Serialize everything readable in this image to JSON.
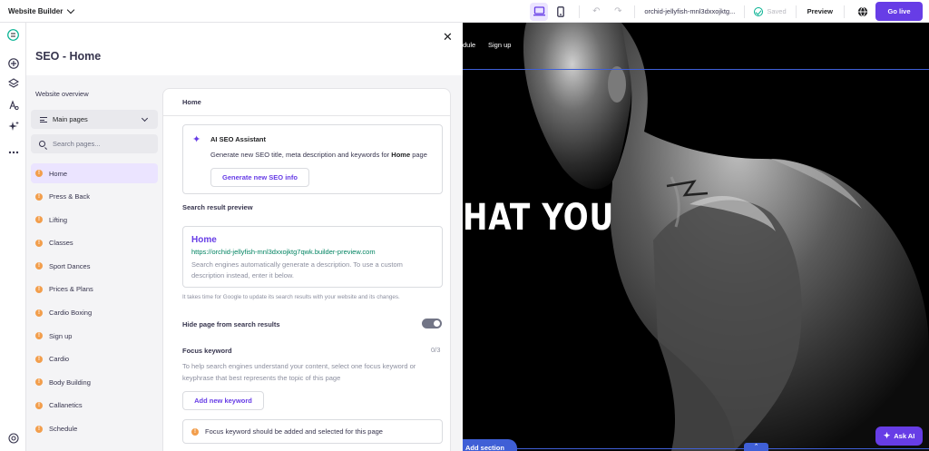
{
  "topbar": {
    "brand": "Website Builder",
    "domain": "orchid-jellyfish-mnl3dxxojktg...",
    "saved_label": "Saved",
    "preview_label": "Preview",
    "go_live_label": "Go live"
  },
  "rail": {
    "icons": [
      "logo-icon",
      "add-icon",
      "layers-icon",
      "style-icon",
      "ai-tools-icon",
      "more-icon",
      "support-icon"
    ]
  },
  "seo": {
    "title": "SEO - Home",
    "overview_label": "Website overview",
    "pages_select_label": "Main pages",
    "search_placeholder": "Search pages...",
    "pages": [
      {
        "label": "Home",
        "active": true
      },
      {
        "label": "Press & Back",
        "active": false
      },
      {
        "label": "Lifting",
        "active": false
      },
      {
        "label": "Classes",
        "active": false
      },
      {
        "label": "Sport Dances",
        "active": false
      },
      {
        "label": "Prices & Plans",
        "active": false
      },
      {
        "label": "Cardio Boxing",
        "active": false
      },
      {
        "label": "Sign up",
        "active": false
      },
      {
        "label": "Cardio",
        "active": false
      },
      {
        "label": "Body Building",
        "active": false
      },
      {
        "label": "Callanetics",
        "active": false
      },
      {
        "label": "Schedule",
        "active": false
      }
    ],
    "card": {
      "header": "Home",
      "ai_title": "AI SEO Assistant",
      "ai_desc_prefix": "Generate new SEO title, meta description and keywords for",
      "ai_desc_page": "Home",
      "ai_desc_suffix": "page",
      "ai_button": "Generate new SEO info",
      "search_preview_label": "Search result preview",
      "serp_title": "Home",
      "serp_url": "https://orchid-jellyfish-mnl3dxxojktg7qwk.builder-preview.com",
      "serp_desc": "Search engines automatically generate a description. To use a custom description instead, enter it below.",
      "serp_note": "It takes time for Google to update its search results with your website and its changes.",
      "hide_label": "Hide page from search results",
      "hide_enabled": false,
      "focus_label": "Focus keyword",
      "focus_count": "0/3",
      "focus_desc": "To help search engines understand your content, select one focus keyword or keyphrase that best represents the topic of this page",
      "add_keyword_button": "Add new keyword",
      "keyword_warning": "Focus keyword should be added and selected for this page"
    }
  },
  "site_preview": {
    "nav_items": [
      "dule",
      "Sign up"
    ],
    "hero_text": "HAT YOU",
    "ask_ai_label": "Ask AI",
    "add_section_label": "Add section"
  },
  "colors": {
    "accent": "#673de6",
    "accent_light": "#ebe4ff",
    "warning": "#f29e4c",
    "url_green": "#008361",
    "selection_blue": "#3f5fd6"
  }
}
